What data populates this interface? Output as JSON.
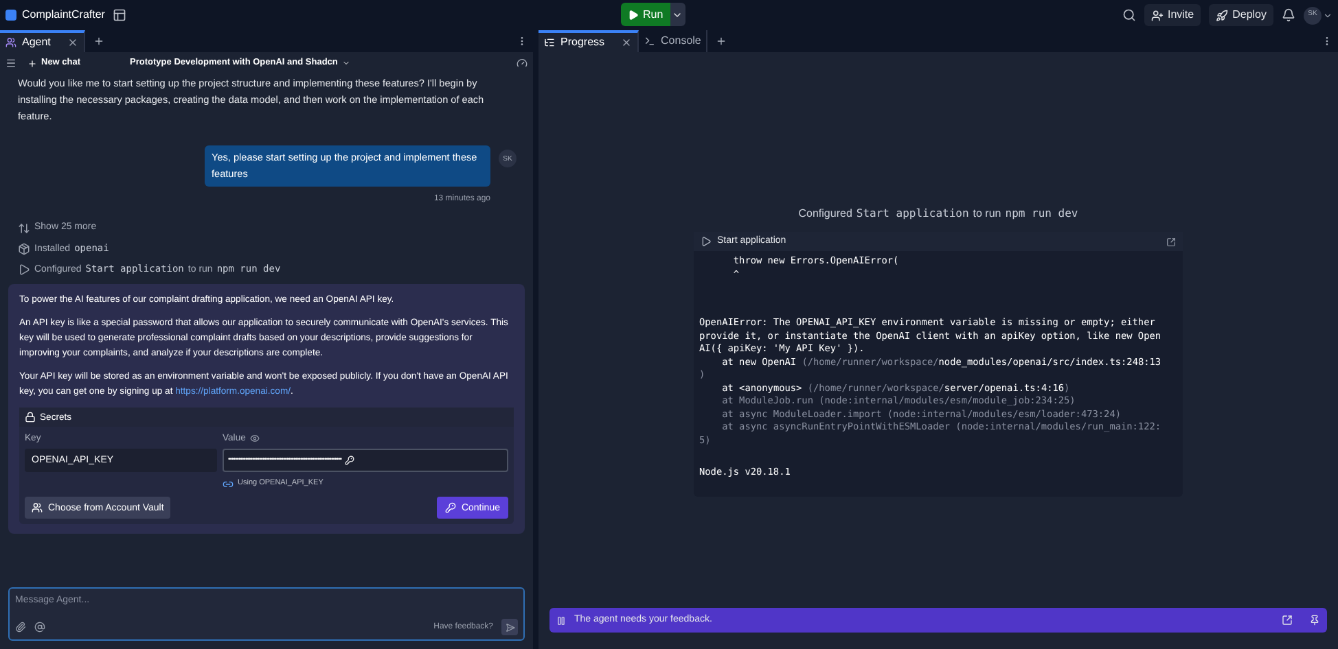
{
  "top_bar": {
    "app_name": "ComplaintCrafter",
    "run_label": "Run",
    "invite_label": "Invite",
    "deploy_label": "Deploy",
    "avatar_initials": "SK"
  },
  "left_panel": {
    "tabs": [
      {
        "label": "Agent",
        "selected": true
      }
    ],
    "chat_header": {
      "new_chat_label": "New chat",
      "title": "Prototype Development with OpenAI and Shadcn"
    },
    "agent_message": "Would you like me to start setting up the project structure and implementing these features? I'll begin by installing the necessary packages, creating the data model, and then work on the implementation of each feature.",
    "user_message": {
      "text": "Yes, please start setting up the project and implement these features",
      "initials": "SK",
      "time": "13 minutes ago"
    },
    "actions": [
      {
        "kind": "expand",
        "parts": [
          {
            "text": "Show 25 more",
            "code": false
          }
        ]
      },
      {
        "kind": "install",
        "parts": [
          {
            "text": "Installed",
            "code": false
          },
          {
            "text": "openai",
            "code": true
          }
        ]
      },
      {
        "kind": "configure",
        "parts": [
          {
            "text": "Configured",
            "code": false
          },
          {
            "text": "Start application",
            "code": true
          },
          {
            "text": "to run",
            "code": false
          },
          {
            "text": "npm run dev",
            "code": true
          }
        ]
      }
    ],
    "api_card": {
      "paragraphs": [
        {
          "text": "To power the AI features of our complaint drafting application, we need an OpenAI API key."
        },
        {
          "text": "An API key is like a special password that allows our application to securely communicate with OpenAI's services. This key will be used to generate professional complaint drafts based on your descriptions, provide suggestions for improving your complaints, and analyze if your descriptions are complete."
        },
        {
          "text": "Your API key will be stored as an environment variable and won't be exposed publicly. If you don't have an OpenAI API key, you can get one by signing up at",
          "link": "https://platform.openai.com/",
          "after": "."
        }
      ],
      "secrets": {
        "title": "Secrets",
        "key_label": "Key",
        "key_value": "OPENAI_API_KEY",
        "value_label": "Value",
        "value_masked": "••••••••••••••••••••••••••••••••••••••••••••••••••••••••••••••••••",
        "using_label": "Using OPENAI_API_KEY",
        "vault_button": "Choose from Account Vault",
        "continue_button": "Continue"
      }
    },
    "composer": {
      "placeholder": "Message Agent...",
      "feedback_label": "Have feedback?"
    }
  },
  "right_panel": {
    "tabs": [
      {
        "label": "Progress",
        "selected": true
      },
      {
        "label": "Console",
        "selected": false
      }
    ],
    "configured_parts": [
      {
        "text": "Configured",
        "code": false
      },
      {
        "text": "Start application",
        "code": true
      },
      {
        "text": "to run",
        "code": false
      },
      {
        "text": "npm run dev",
        "code": true
      }
    ],
    "console": {
      "title": "Start application",
      "blocks": [
        {
          "lines": [
            {
              "text": "      throw new Errors.OpenAIError(",
              "dim": false
            },
            {
              "text": "      ^",
              "dim": false
            }
          ]
        },
        {
          "lines": [
            {
              "text": "OpenAIError: The OPENAI_API_KEY environment variable is missing or empty; either",
              "dim": false
            },
            {
              "text": "provide it, or instantiate the OpenAI client with an apiKey option, like new Open",
              "dim": false
            },
            {
              "text": "AI({ apiKey: 'My API Key' }).",
              "dim": false
            },
            {
              "text": "    **at new OpenAI** (/home/runner/workspace/**node_modules/openai/src/index.ts:248:13**",
              "dim": true
            },
            {
              "text": ")",
              "dim": true
            },
            {
              "text": "    **at <anonymous>** (/home/runner/workspace/**server/openai.ts:4:16**)",
              "dim": true
            },
            {
              "text": "    at ModuleJob.run (node:internal/modules/esm/module_job:234:25)",
              "dim": true
            },
            {
              "text": "    at async ModuleLoader.import (node:internal/modules/esm/loader:473:24)",
              "dim": true
            },
            {
              "text": "    at async asyncRunEntryPointWithESMLoader (node:internal/modules/run_main:122:",
              "dim": true
            },
            {
              "text": "5)",
              "dim": true
            }
          ]
        },
        {
          "lines": [
            {
              "text": "Node.js v20.18.1",
              "dim": false
            }
          ]
        }
      ]
    },
    "feedback_banner": "The agent needs your feedback."
  }
}
